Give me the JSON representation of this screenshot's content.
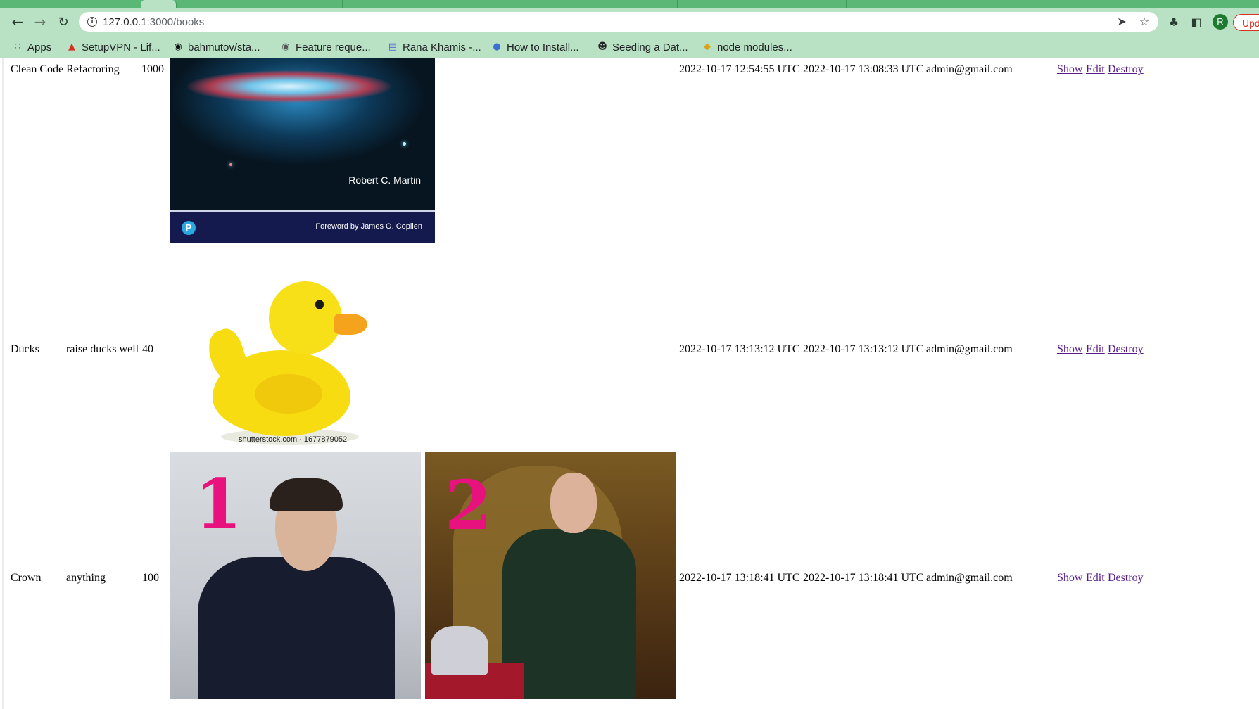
{
  "browser": {
    "url_host": "127.0.0.1",
    "url_path": ":3000/books",
    "profile_initial": "R",
    "update_label": "Upd",
    "bookmarks": [
      {
        "icon": "apps-grid-icon",
        "label": "Apps"
      },
      {
        "icon": "vpn-icon",
        "label": "SetupVPN - Lif..."
      },
      {
        "icon": "github-icon",
        "label": "bahmutov/sta..."
      },
      {
        "icon": "github-icon",
        "label": "Feature reque..."
      },
      {
        "icon": "doc-icon",
        "label": "Rana Khamis -..."
      },
      {
        "icon": "globe-icon",
        "label": "How to Install..."
      },
      {
        "icon": "person-icon",
        "label": "Seeding a Dat..."
      },
      {
        "icon": "node-icon",
        "label": "node modules..."
      }
    ]
  },
  "books": [
    {
      "title": "Clean Code Refactoring",
      "description": "",
      "price": "1000",
      "created_at": "2022-10-17 12:54:55 UTC",
      "updated_at": "2022-10-17 13:08:33 UTC",
      "user": "admin@gmail.com",
      "cover_author": "Robert C. Martin",
      "cover_foreword": "Foreword by James O. Coplien",
      "cover_logo": "P",
      "actions": {
        "show": "Show",
        "edit": "Edit",
        "destroy": "Destroy"
      }
    },
    {
      "title": "Ducks",
      "description": "raise ducks well",
      "price": "40",
      "created_at": "2022-10-17 13:13:12 UTC",
      "updated_at": "2022-10-17 13:13:12 UTC",
      "user": "admin@gmail.com",
      "image_watermark": "shutterstock.com · 1677879052",
      "actions": {
        "show": "Show",
        "edit": "Edit",
        "destroy": "Destroy"
      }
    },
    {
      "title": "Crown",
      "description": "anything",
      "price": "100",
      "created_at": "2022-10-17 13:18:41 UTC",
      "updated_at": "2022-10-17 13:18:41 UTC",
      "user": "admin@gmail.com",
      "image_labels": [
        "1",
        "2"
      ],
      "actions": {
        "show": "Show",
        "edit": "Edit",
        "destroy": "Destroy"
      }
    }
  ]
}
